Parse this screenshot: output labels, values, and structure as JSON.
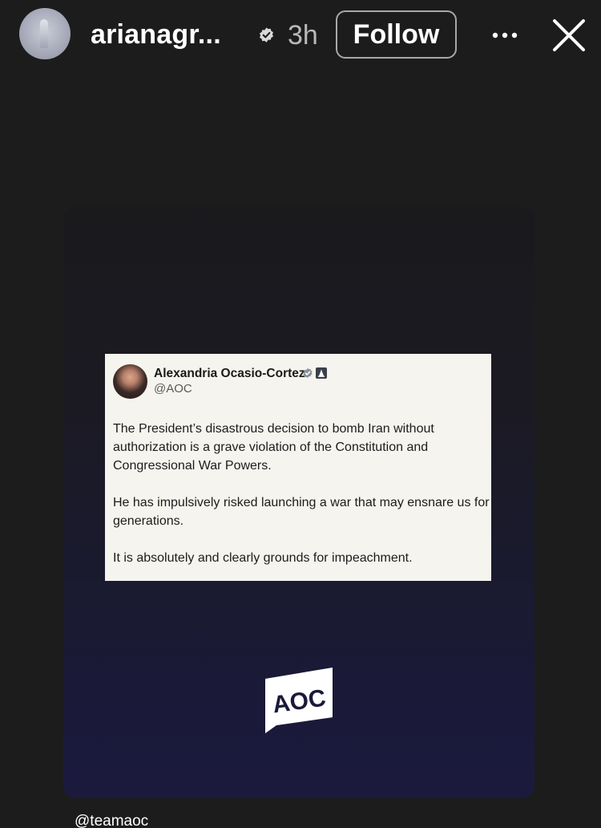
{
  "header": {
    "username": "arianagr...",
    "time_ago": "3h",
    "follow_label": "Follow",
    "more_label": "···"
  },
  "post": {
    "author_name": "Alexandria Ocasio-Cortez",
    "author_handle": "@AOC",
    "paragraphs": [
      "The President’s disastrous decision to bomb Iran without authorization is a grave violation of the Constitution and Congressional War Powers.",
      "He has impulsively risked launching a war that may ensnare us for generations.",
      "It is absolutely and clearly grounds for impeachment."
    ],
    "logo_text": "AOC"
  },
  "mention": "@teamaoc",
  "colors": {
    "background": "#1c1c1d",
    "card_bottom": "#1b1a3d",
    "tweet_paper": "#f6f4ee",
    "verified_blue_gray": "#8a8f99"
  },
  "icons": {
    "header_verified": "verified-badge-icon",
    "more": "more-options-icon",
    "close": "close-icon",
    "tweet_verified": "verified-badge-icon",
    "tweet_gov": "government-badge-icon"
  }
}
